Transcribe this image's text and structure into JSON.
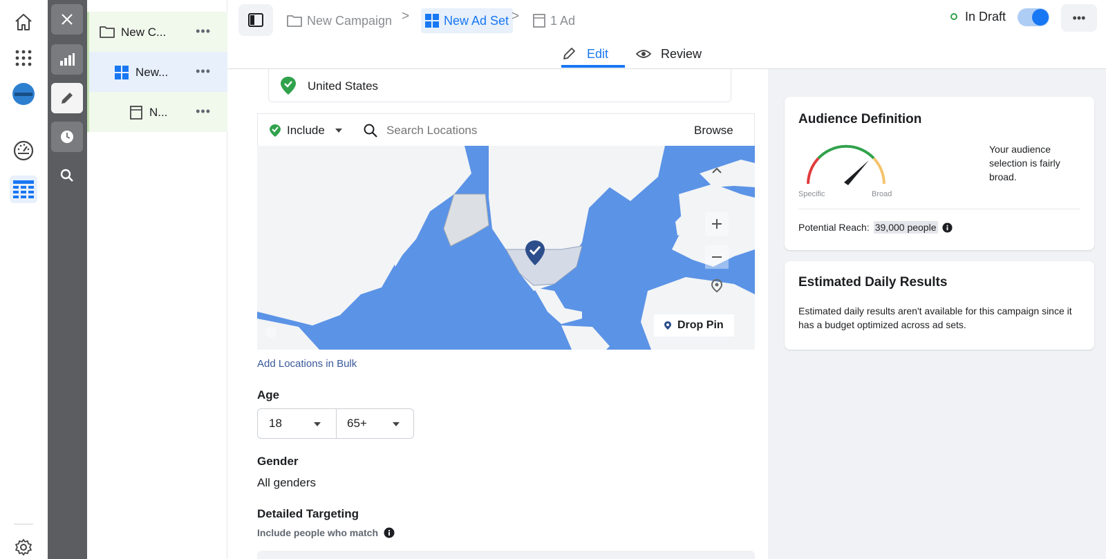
{
  "tree": {
    "campaign_label": "New C...",
    "adset_label": "New...",
    "ad_label": "N...",
    "more": "•••"
  },
  "breadcrumb": {
    "campaign": "New Campaign",
    "adset": "New Ad Set",
    "ad": "1 Ad"
  },
  "status": {
    "label": "In Draft",
    "toggle_on": true
  },
  "header_more": "•••",
  "tabs": {
    "edit": "Edit",
    "review": "Review"
  },
  "location": {
    "selected_country": "United States",
    "include_label": "Include",
    "search_placeholder": "Search Locations",
    "browse_label": "Browse",
    "drop_pin_label": "Drop Pin",
    "add_bulk_link": "Add Locations in Bulk"
  },
  "age": {
    "label": "Age",
    "min": "18",
    "max": "65+"
  },
  "gender": {
    "label": "Gender",
    "value": "All genders"
  },
  "detailed_targeting": {
    "label": "Detailed Targeting",
    "sublabel": "Include people who match"
  },
  "audience": {
    "title": "Audience Definition",
    "gauge_left": "Specific",
    "gauge_right": "Broad",
    "description": "Your audience selection is fairly broad.",
    "reach_label": "Potential Reach:",
    "reach_value": "39,000 people"
  },
  "estimated": {
    "title": "Estimated Daily Results",
    "text": "Estimated daily results aren't available for this campaign since it has a budget optimized across ad sets."
  },
  "colors": {
    "accent": "#1877f2",
    "green": "#31a24c",
    "tool_dark": "#5c5d60",
    "map_ocean": "#5b93e6",
    "map_land": "#f2f4f6"
  }
}
